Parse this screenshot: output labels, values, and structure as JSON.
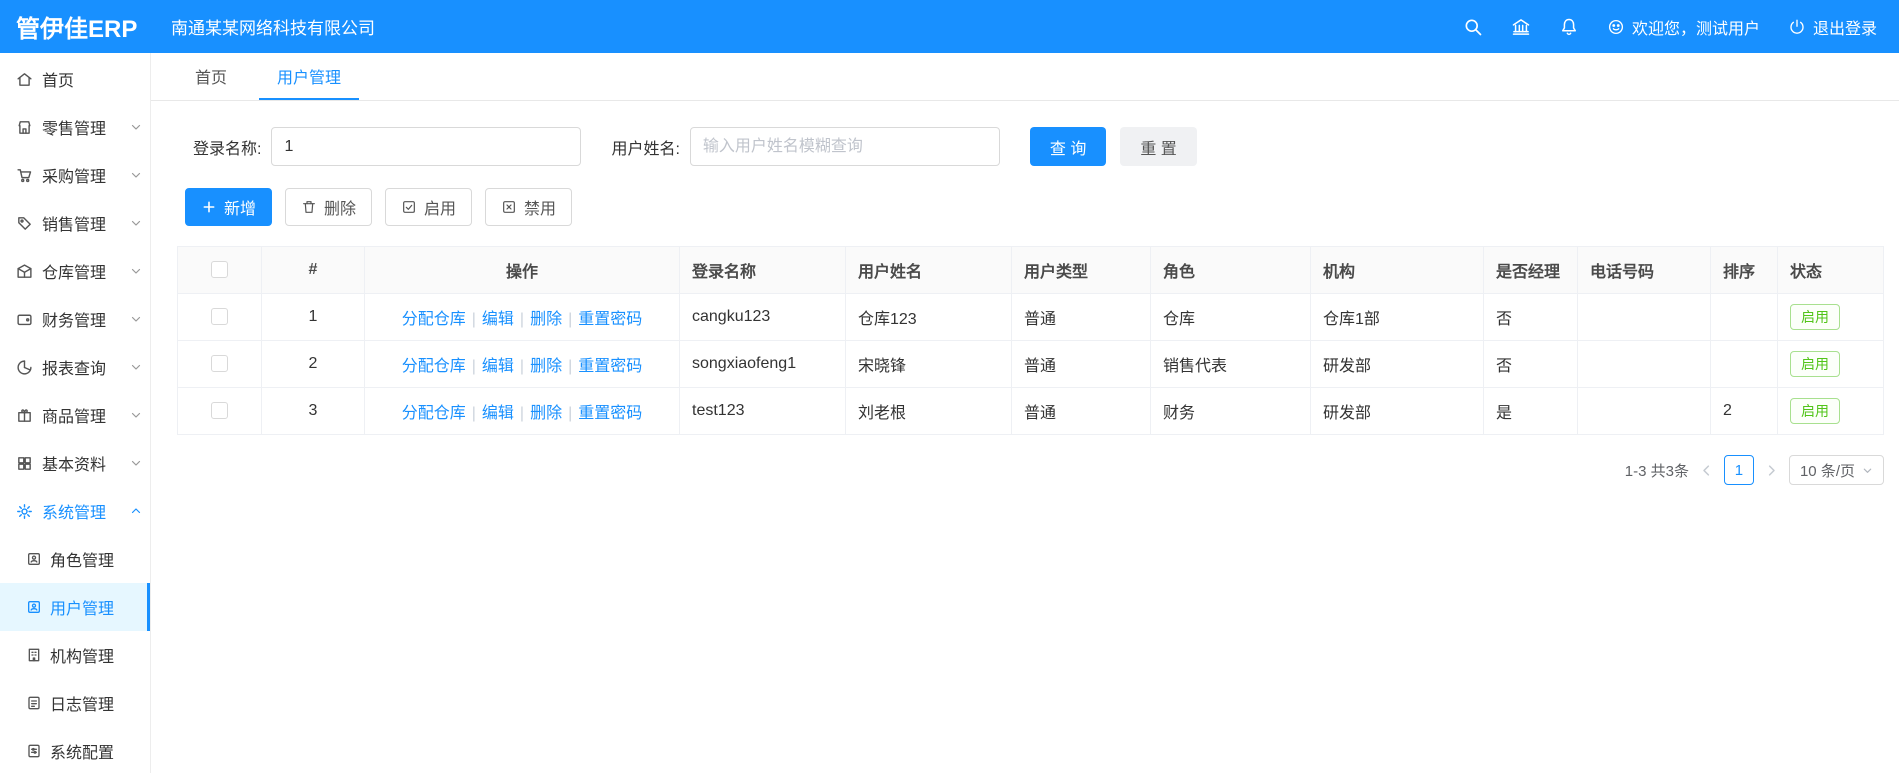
{
  "topbar": {
    "logo": "管伊佳ERP",
    "company": "南通某某网络科技有限公司",
    "welcome": "欢迎您，测试用户",
    "logout": "退出登录"
  },
  "tabs": [
    {
      "label": "首页"
    },
    {
      "label": "用户管理"
    }
  ],
  "sidebar": {
    "items": [
      {
        "label": "首页"
      },
      {
        "label": "零售管理"
      },
      {
        "label": "采购管理"
      },
      {
        "label": "销售管理"
      },
      {
        "label": "仓库管理"
      },
      {
        "label": "财务管理"
      },
      {
        "label": "报表查询"
      },
      {
        "label": "商品管理"
      },
      {
        "label": "基本资料"
      },
      {
        "label": "系统管理"
      }
    ],
    "submenu": [
      {
        "label": "角色管理"
      },
      {
        "label": "用户管理"
      },
      {
        "label": "机构管理"
      },
      {
        "label": "日志管理"
      },
      {
        "label": "系统配置"
      }
    ]
  },
  "search": {
    "login_label": "登录名称:",
    "login_value": "1",
    "name_label": "用户姓名:",
    "name_placeholder": "输入用户姓名模糊查询",
    "search_btn": "查 询",
    "reset_btn": "重 置"
  },
  "toolbar": {
    "add": "新增",
    "delete": "删除",
    "enable": "启用",
    "disable": "禁用"
  },
  "table": {
    "headers": [
      "#",
      "操作",
      "登录名称",
      "用户姓名",
      "用户类型",
      "角色",
      "机构",
      "是否经理",
      "电话号码",
      "排序",
      "状态"
    ],
    "op_links": [
      "分配仓库",
      "编辑",
      "删除",
      "重置密码"
    ],
    "op_sep": "|",
    "rows": [
      {
        "num": "1",
        "login": "cangku123",
        "name": "仓库123",
        "type": "普通",
        "role": "仓库",
        "org": "仓库1部",
        "manager": "否",
        "phone": "",
        "sort": "",
        "status": "启用"
      },
      {
        "num": "2",
        "login": "songxiaofeng1",
        "name": "宋晓锋",
        "type": "普通",
        "role": "销售代表",
        "org": "研发部",
        "manager": "否",
        "phone": "",
        "sort": "",
        "status": "启用"
      },
      {
        "num": "3",
        "login": "test123",
        "name": "刘老根",
        "type": "普通",
        "role": "财务",
        "org": "研发部",
        "manager": "是",
        "phone": "",
        "sort": "2",
        "status": "启用"
      }
    ]
  },
  "pagination": {
    "total": "1-3 共3条",
    "page": "1",
    "per_page": "10 条/页"
  },
  "colors": {
    "primary": "#1890ff",
    "success": "#52c41a"
  }
}
